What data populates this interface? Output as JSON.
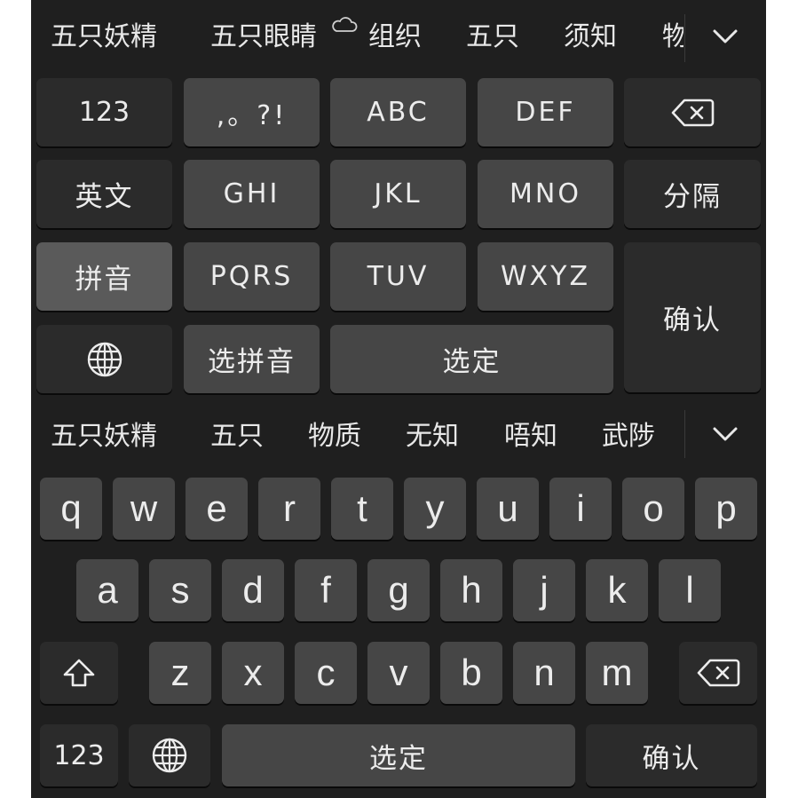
{
  "t9_keyboard": {
    "candidates": [
      "五只妖精",
      "五只眼睛",
      "组织",
      "五只",
      "须知",
      "物"
    ],
    "keys": {
      "num": "123",
      "punct": ",。?!",
      "abc": "ABC",
      "def": "DEF",
      "english": "英文",
      "ghi": "GHI",
      "jkl": "JKL",
      "mno": "MNO",
      "separator": "分隔",
      "pinyin": "拼音",
      "pqrs": "PQRS",
      "tuv": "TUV",
      "wxyz": "WXYZ",
      "confirm": "确认",
      "select_pinyin": "选拼音",
      "select": "选定"
    }
  },
  "qwerty_keyboard": {
    "candidates": [
      "五只妖精",
      "五只",
      "物质",
      "无知",
      "唔知",
      "武陟"
    ],
    "row1": [
      "q",
      "w",
      "e",
      "r",
      "t",
      "y",
      "u",
      "i",
      "o",
      "p"
    ],
    "row2": [
      "a",
      "s",
      "d",
      "f",
      "g",
      "h",
      "j",
      "k",
      "l"
    ],
    "row3": [
      "z",
      "x",
      "c",
      "v",
      "b",
      "n",
      "m"
    ],
    "bottom": {
      "num": "123",
      "select": "选定",
      "confirm": "确认"
    }
  },
  "colors": {
    "keyboard_bg": "#1f1f1f",
    "key_light": "#464646",
    "key_dark": "#2b2b2b",
    "key_selected": "#5a5a5a",
    "text": "#ececec"
  }
}
